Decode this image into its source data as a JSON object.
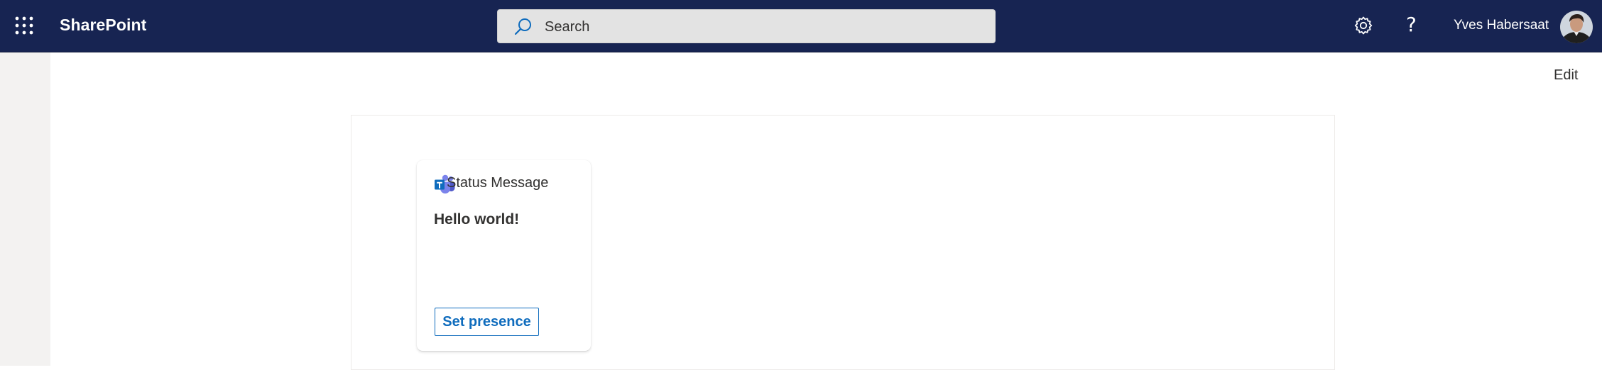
{
  "header": {
    "app_launcher_icon": "waffle-icon",
    "brand": "SharePoint",
    "search": {
      "icon": "search-icon",
      "placeholder": "Search"
    },
    "settings_icon": "gear-icon",
    "help_label": "?",
    "user_name": "Yves Habersaat",
    "avatar": "user-avatar",
    "bg_color": "#172452"
  },
  "page": {
    "edit_label": "Edit"
  },
  "card": {
    "icon": "teams-icon",
    "title": "Status Message",
    "message": "Hello world!",
    "action_label": "Set presence",
    "accent_color": "#0f6cbd"
  }
}
